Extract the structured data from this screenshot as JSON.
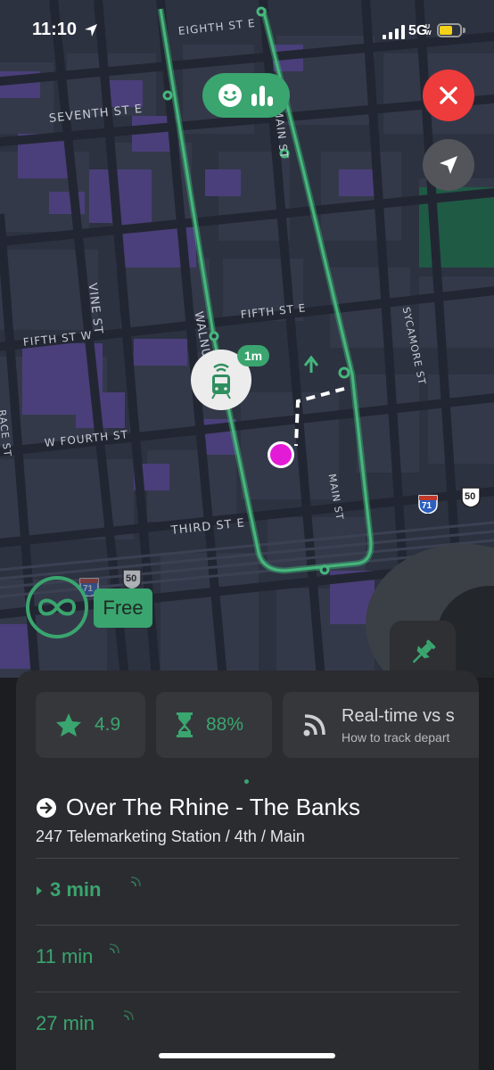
{
  "status": {
    "time": "11:10",
    "network": "5G",
    "network_sup": "UW"
  },
  "map": {
    "streets": [
      "EIGHTH ST E",
      "SEVENTH ST E",
      "MAIN ST",
      "VINE ST",
      "WALNUT ST",
      "FIFTH ST E",
      "FIFTH ST W",
      "SYCAMORE ST",
      "RACE ST",
      "W FOURTH ST",
      "MAIN ST",
      "THIRD ST E"
    ],
    "shields": [
      "71",
      "50",
      "71",
      "50"
    ],
    "vehicle_badge": "1m",
    "free_label": "Free"
  },
  "sheet": {
    "rating": "4.9",
    "accuracy": "88%",
    "realtime_title": "Real-time vs s",
    "realtime_sub": "How to track depart",
    "route_name": "Over The Rhine - The Banks",
    "stop": "247 Telemarketing Station / 4th / Main",
    "departures": [
      "3 min",
      "11 min",
      "27 min"
    ]
  },
  "colors": {
    "accent": "#3aa56f",
    "close": "#ee3b3b",
    "map_bg": "#2c3240",
    "building": "#4a3f7a",
    "you": "#e31bd6"
  }
}
